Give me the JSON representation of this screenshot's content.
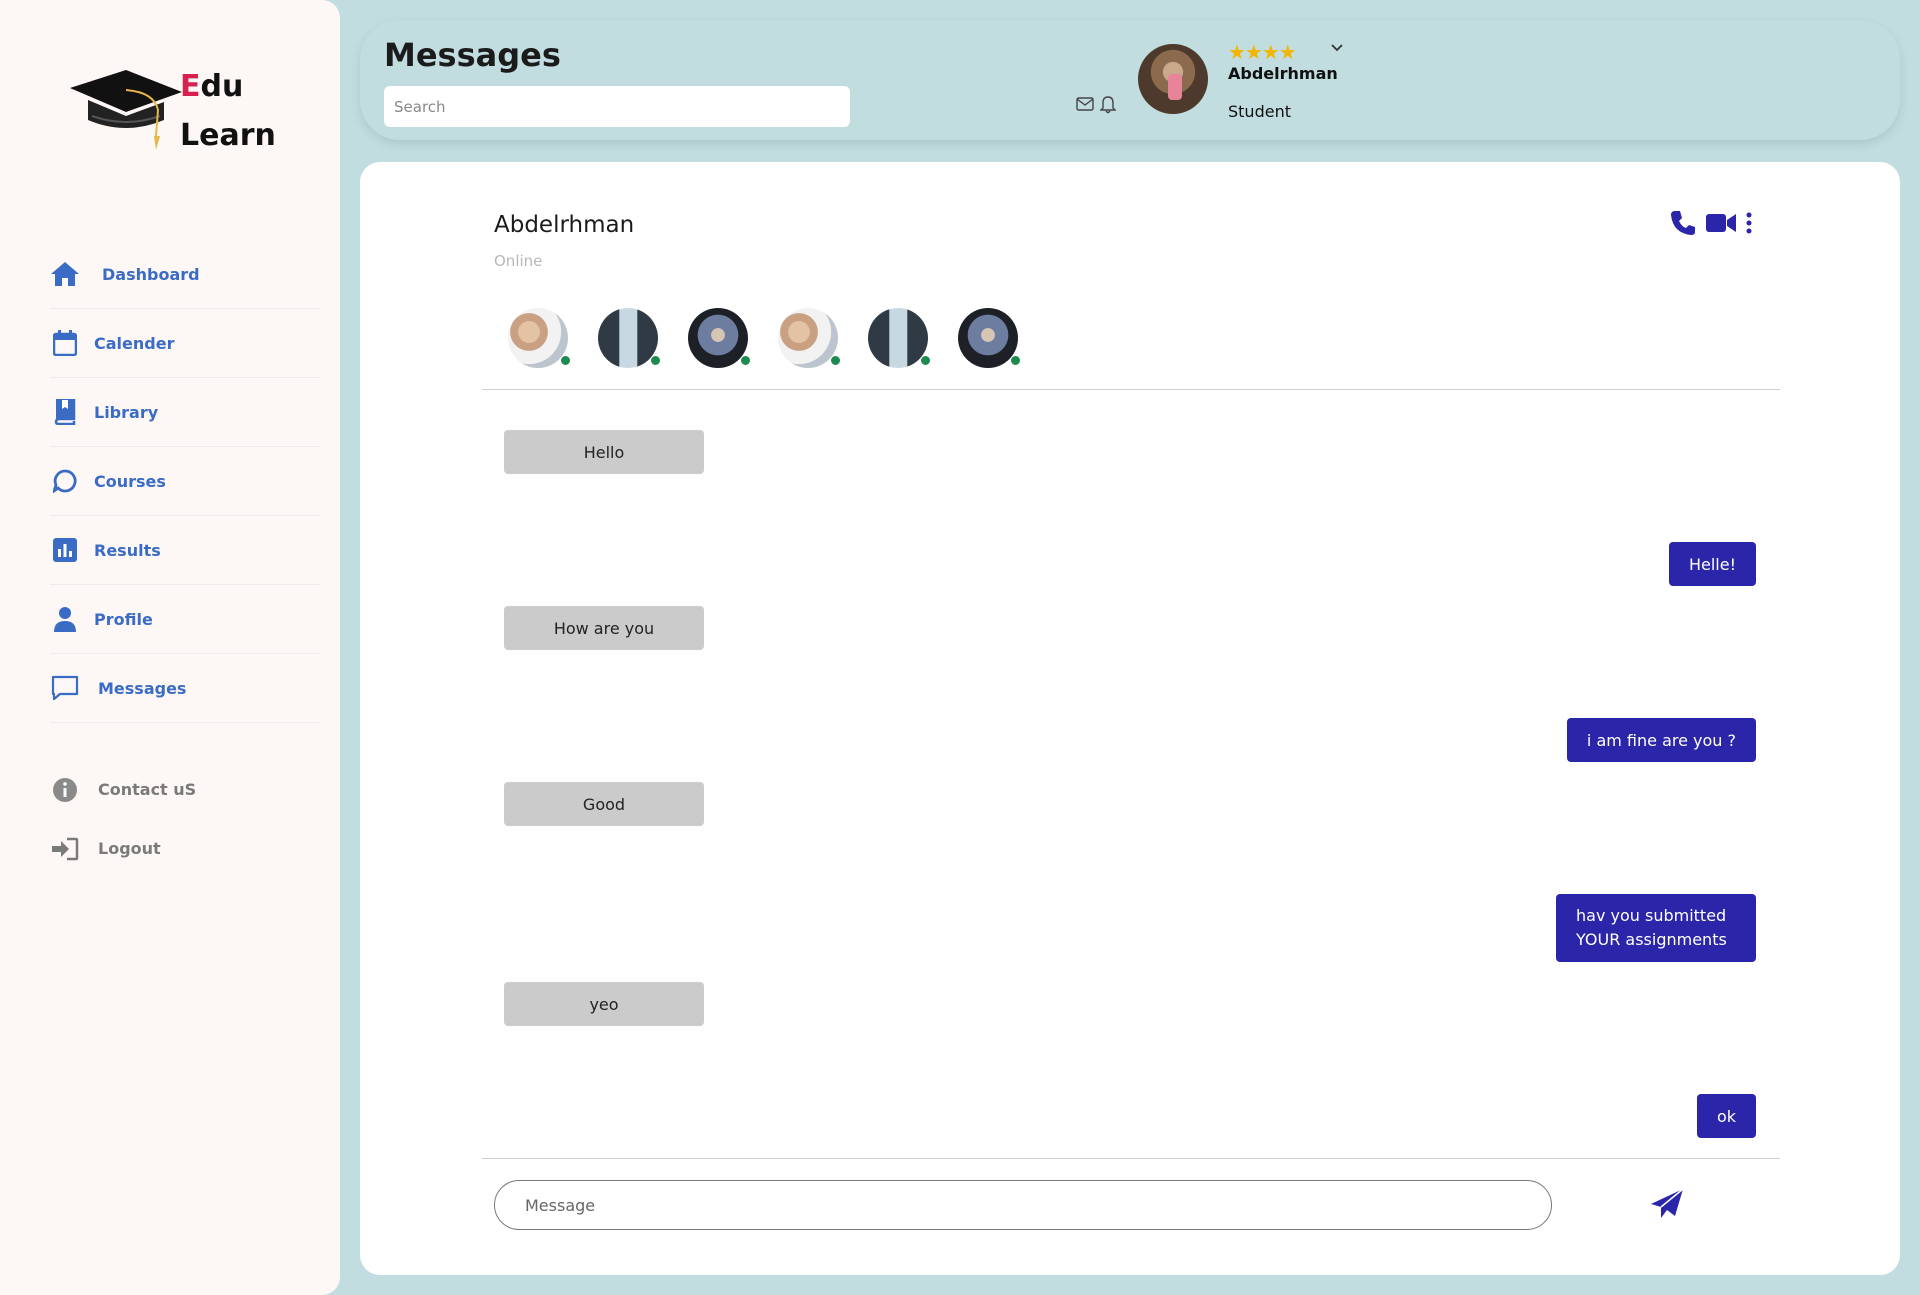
{
  "logo": {
    "first_letter": "E",
    "line1_rest": "du",
    "line2": "Learn"
  },
  "sidebar": {
    "items": [
      {
        "label": "Dashboard",
        "icon": "home-icon"
      },
      {
        "label": "Calender",
        "icon": "calendar-icon"
      },
      {
        "label": "Library",
        "icon": "book-icon"
      },
      {
        "label": "Courses",
        "icon": "chat-circle-icon"
      },
      {
        "label": "Results",
        "icon": "bar-chart-icon"
      },
      {
        "label": "Profile",
        "icon": "user-icon"
      },
      {
        "label": "Messages",
        "icon": "message-square-icon"
      }
    ],
    "bottom_items": [
      {
        "label": "Contact uS",
        "icon": "info-icon"
      },
      {
        "label": "Logout",
        "icon": "logout-icon"
      }
    ],
    "accent_color": "#3a6cc5"
  },
  "header": {
    "title": "Messages",
    "search_placeholder": "Search",
    "user": {
      "name": "Abdelrhman",
      "role": "Student",
      "stars": "★★★★"
    }
  },
  "chat": {
    "contact_name": "Abdelrhman",
    "contact_status": "Online",
    "send_color": "#2b26a9",
    "messages": [
      {
        "from": "them",
        "text": "Hello"
      },
      {
        "from": "me",
        "text": "Helle!"
      },
      {
        "from": "them",
        "text": "How are you"
      },
      {
        "from": "me",
        "text": "i am fine are you ?"
      },
      {
        "from": "them",
        "text": "Good"
      },
      {
        "from": "me",
        "line1": "hav you submitted",
        "line2": "YOUR assignments"
      },
      {
        "from": "them",
        "text": "yeo"
      },
      {
        "from": "me",
        "text": "ok"
      }
    ],
    "input_placeholder": "Message"
  }
}
